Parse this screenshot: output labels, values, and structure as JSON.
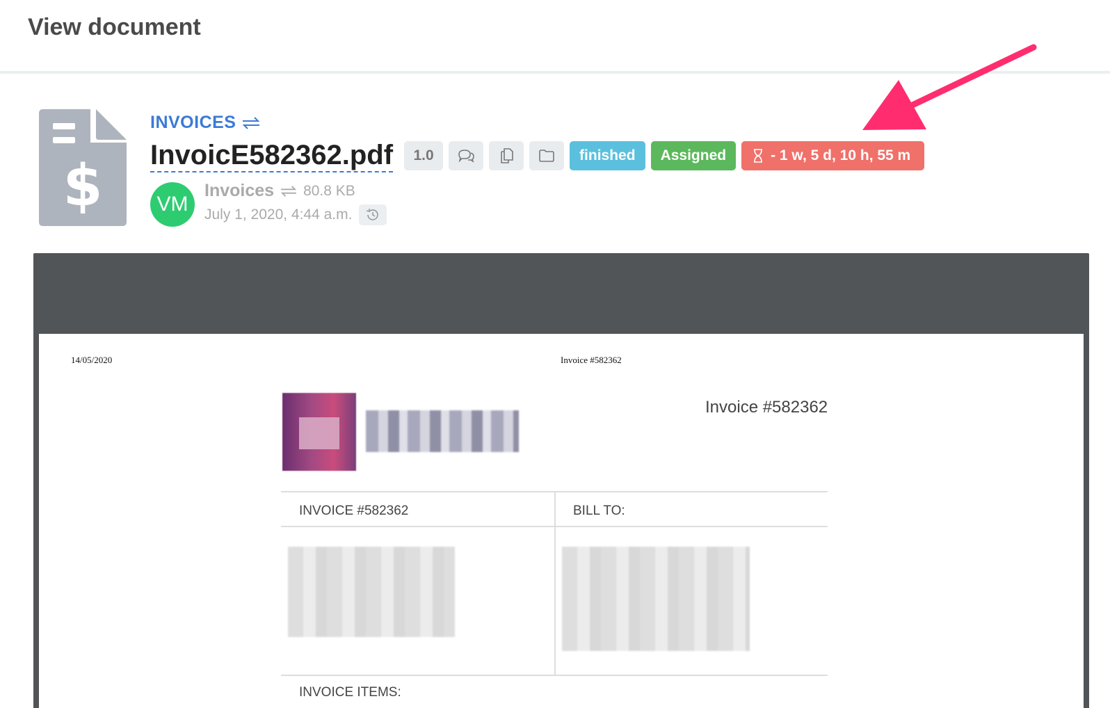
{
  "page": {
    "title": "View document"
  },
  "document": {
    "category": "INVOICES",
    "file_name": "InvoicE582362.pdf",
    "version": "1.0",
    "status": "finished",
    "assignment": "Assigned",
    "deadline": "- 1 w, 5 d, 10 h, 55 m",
    "owner_initials": "VM",
    "owner_category": "Invoices",
    "file_size": "80.8 KB",
    "created": "July 1, 2020, 4:44 a.m."
  },
  "colors": {
    "category_link": "#3a7bd5",
    "finished": "#5bc0de",
    "assigned": "#5cb85c",
    "deadline": "#f0706a",
    "avatar": "#2ecc71",
    "arrow": "#ff2d6f"
  },
  "icons": {
    "document": "invoice-file-icon",
    "swap": "swap-icon",
    "comments": "comments-icon",
    "copy": "copy-document-icon",
    "folder": "folder-icon",
    "timer": "hourglass-icon",
    "history": "history-icon"
  },
  "pdf": {
    "date": "14/05/2020",
    "header": "Invoice #582362",
    "invoice_title": "Invoice #582362",
    "invoice_label": "INVOICE #582362",
    "bill_to_label": "BILL TO:",
    "items_label": "INVOICE ITEMS:"
  }
}
